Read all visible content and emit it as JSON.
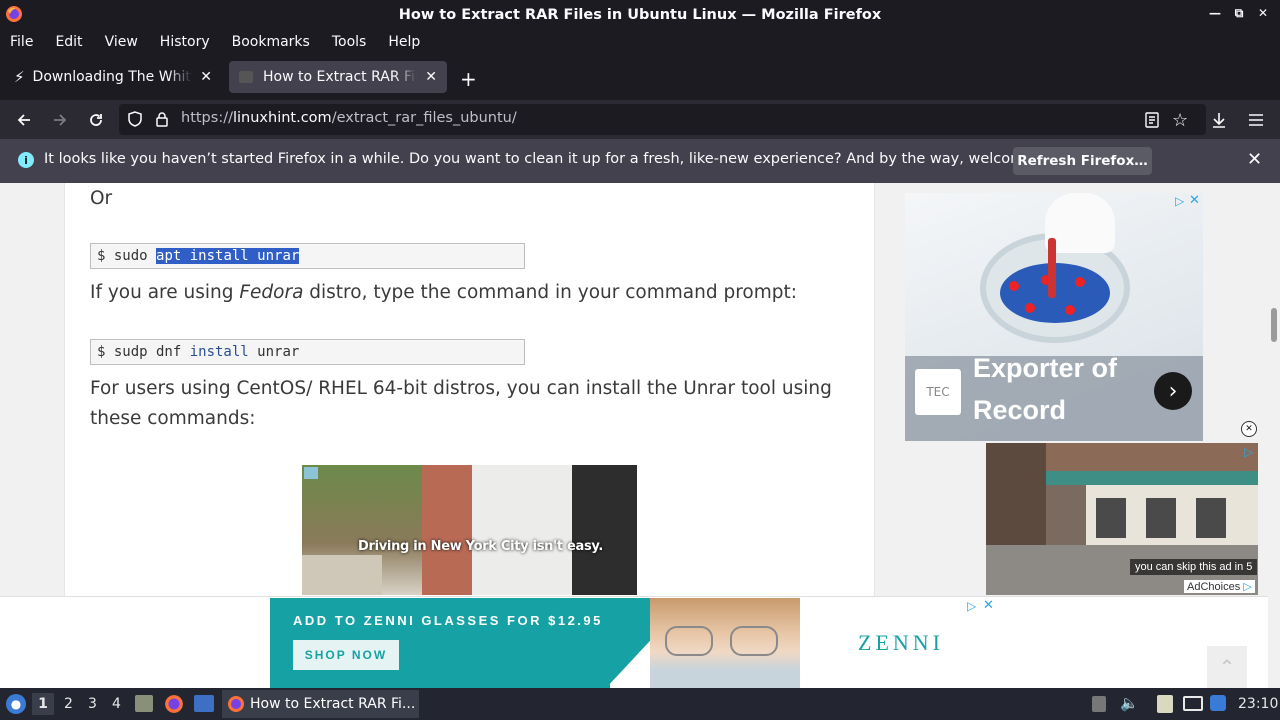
{
  "window": {
    "title": "How to Extract RAR Files in Ubuntu Linux — Mozilla Firefox"
  },
  "menu": [
    "File",
    "Edit",
    "View",
    "History",
    "Bookmarks",
    "Tools",
    "Help"
  ],
  "tabs": [
    {
      "title": "Downloading The White House",
      "active": false
    },
    {
      "title": "How to Extract RAR Files in Ubuntu Linux",
      "active": true
    }
  ],
  "url": {
    "scheme": "https://",
    "domain": "linuxhint.com",
    "path": "/extract_rar_files_ubuntu/"
  },
  "notification": {
    "message": "It looks like you haven’t started Firefox in a while. Do you want to clean it up for a fresh, like-new experience? And by the way, welcome back!",
    "button": "Refresh Firefox…"
  },
  "article": {
    "or": "Or",
    "code1": {
      "prompt": "$ ",
      "cmd": "sudo ",
      "selected": "apt install unrar"
    },
    "fedora_pre": "If you are using ",
    "fedora_em": "Fedora",
    "fedora_post": " distro, type the command in your command prompt:",
    "code2": {
      "prompt": "$ ",
      "a": "sudp dnf ",
      "kw": "install",
      "b": " unrar"
    },
    "centos_line1": "For users using CentOS/ RHEL 64-bit distros, you can install the Unrar tool using",
    "centos_line2": "these commands:",
    "video_caption": "Driving in New York City isn't easy."
  },
  "ads": {
    "side_ad_title_line1": "Exporter of",
    "side_ad_title_line2": "Record",
    "side_ad_logo": "TEC",
    "video_ad_skip": "you can skip this ad in 5",
    "adchoices": "AdChoices",
    "bottom_headline": "ADD TO ZENNI GLASSES FOR $12.95",
    "bottom_cta": "SHOP NOW",
    "bottom_brand": "ZENNI"
  },
  "taskbar": {
    "workspaces": [
      "1",
      "2",
      "3",
      "4"
    ],
    "active_window": "How to Extract RAR Fi...",
    "clock": "23:10"
  },
  "colors": {
    "chrome_dark": "#1c1b22",
    "toolbar": "#2b2a33",
    "selection": "#2f5ec7",
    "zenni_teal": "#1ba3a8"
  }
}
